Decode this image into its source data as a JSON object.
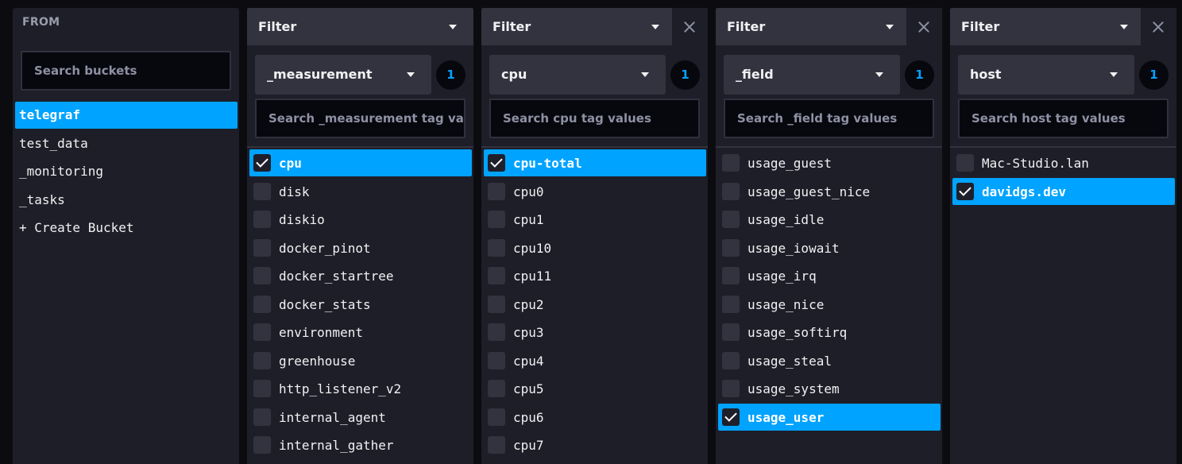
{
  "from": {
    "title": "FROM",
    "search_placeholder": "Search buckets",
    "buckets": [
      {
        "label": "telegraf",
        "selected": true
      },
      {
        "label": "test_data",
        "selected": false
      },
      {
        "label": "_monitoring",
        "selected": false
      },
      {
        "label": "_tasks",
        "selected": false
      },
      {
        "label": "+ Create Bucket",
        "selected": false
      }
    ]
  },
  "filters": [
    {
      "header": "Filter",
      "key": "_measurement",
      "count": "1",
      "search_placeholder": "Search _measurement tag va",
      "closable": false,
      "values": [
        {
          "label": "cpu",
          "selected": true
        },
        {
          "label": "disk",
          "selected": false
        },
        {
          "label": "diskio",
          "selected": false
        },
        {
          "label": "docker_pinot",
          "selected": false
        },
        {
          "label": "docker_startree",
          "selected": false
        },
        {
          "label": "docker_stats",
          "selected": false
        },
        {
          "label": "environment",
          "selected": false
        },
        {
          "label": "greenhouse",
          "selected": false
        },
        {
          "label": "http_listener_v2",
          "selected": false
        },
        {
          "label": "internal_agent",
          "selected": false
        },
        {
          "label": "internal_gather",
          "selected": false
        }
      ]
    },
    {
      "header": "Filter",
      "key": "cpu",
      "count": "1",
      "search_placeholder": "Search cpu tag values",
      "closable": true,
      "values": [
        {
          "label": "cpu-total",
          "selected": true
        },
        {
          "label": "cpu0",
          "selected": false
        },
        {
          "label": "cpu1",
          "selected": false
        },
        {
          "label": "cpu10",
          "selected": false
        },
        {
          "label": "cpu11",
          "selected": false
        },
        {
          "label": "cpu2",
          "selected": false
        },
        {
          "label": "cpu3",
          "selected": false
        },
        {
          "label": "cpu4",
          "selected": false
        },
        {
          "label": "cpu5",
          "selected": false
        },
        {
          "label": "cpu6",
          "selected": false
        },
        {
          "label": "cpu7",
          "selected": false
        }
      ]
    },
    {
      "header": "Filter",
      "key": "_field",
      "count": "1",
      "search_placeholder": "Search _field tag values",
      "closable": true,
      "values": [
        {
          "label": "usage_guest",
          "selected": false
        },
        {
          "label": "usage_guest_nice",
          "selected": false
        },
        {
          "label": "usage_idle",
          "selected": false
        },
        {
          "label": "usage_iowait",
          "selected": false
        },
        {
          "label": "usage_irq",
          "selected": false
        },
        {
          "label": "usage_nice",
          "selected": false
        },
        {
          "label": "usage_softirq",
          "selected": false
        },
        {
          "label": "usage_steal",
          "selected": false
        },
        {
          "label": "usage_system",
          "selected": false
        },
        {
          "label": "usage_user",
          "selected": true
        }
      ]
    },
    {
      "header": "Filter",
      "key": "host",
      "count": "1",
      "search_placeholder": "Search host tag values",
      "closable": true,
      "values": [
        {
          "label": "Mac-Studio.lan",
          "selected": false
        },
        {
          "label": "davidgs.dev",
          "selected": true
        }
      ]
    }
  ],
  "colors": {
    "accent": "#00a3ff",
    "panel": "#1e1e29",
    "header": "#33333f",
    "background": "#0c0c10"
  }
}
